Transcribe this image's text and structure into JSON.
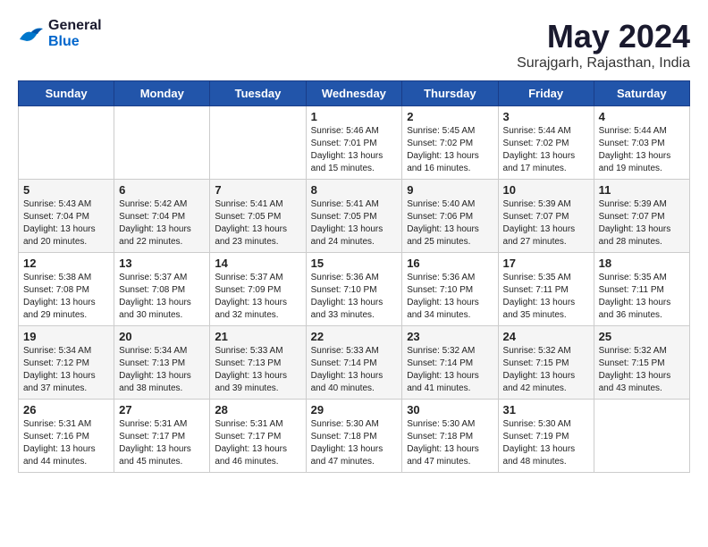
{
  "logo": {
    "line1": "General",
    "line2": "Blue"
  },
  "title": "May 2024",
  "subtitle": "Surajgarh, Rajasthan, India",
  "days_of_week": [
    "Sunday",
    "Monday",
    "Tuesday",
    "Wednesday",
    "Thursday",
    "Friday",
    "Saturday"
  ],
  "weeks": [
    [
      {
        "day": "",
        "info": ""
      },
      {
        "day": "",
        "info": ""
      },
      {
        "day": "",
        "info": ""
      },
      {
        "day": "1",
        "sunrise": "5:46 AM",
        "sunset": "7:01 PM",
        "daylight": "13 hours and 15 minutes."
      },
      {
        "day": "2",
        "sunrise": "5:45 AM",
        "sunset": "7:02 PM",
        "daylight": "13 hours and 16 minutes."
      },
      {
        "day": "3",
        "sunrise": "5:44 AM",
        "sunset": "7:02 PM",
        "daylight": "13 hours and 17 minutes."
      },
      {
        "day": "4",
        "sunrise": "5:44 AM",
        "sunset": "7:03 PM",
        "daylight": "13 hours and 19 minutes."
      }
    ],
    [
      {
        "day": "5",
        "sunrise": "5:43 AM",
        "sunset": "7:04 PM",
        "daylight": "13 hours and 20 minutes."
      },
      {
        "day": "6",
        "sunrise": "5:42 AM",
        "sunset": "7:04 PM",
        "daylight": "13 hours and 22 minutes."
      },
      {
        "day": "7",
        "sunrise": "5:41 AM",
        "sunset": "7:05 PM",
        "daylight": "13 hours and 23 minutes."
      },
      {
        "day": "8",
        "sunrise": "5:41 AM",
        "sunset": "7:05 PM",
        "daylight": "13 hours and 24 minutes."
      },
      {
        "day": "9",
        "sunrise": "5:40 AM",
        "sunset": "7:06 PM",
        "daylight": "13 hours and 25 minutes."
      },
      {
        "day": "10",
        "sunrise": "5:39 AM",
        "sunset": "7:07 PM",
        "daylight": "13 hours and 27 minutes."
      },
      {
        "day": "11",
        "sunrise": "5:39 AM",
        "sunset": "7:07 PM",
        "daylight": "13 hours and 28 minutes."
      }
    ],
    [
      {
        "day": "12",
        "sunrise": "5:38 AM",
        "sunset": "7:08 PM",
        "daylight": "13 hours and 29 minutes."
      },
      {
        "day": "13",
        "sunrise": "5:37 AM",
        "sunset": "7:08 PM",
        "daylight": "13 hours and 30 minutes."
      },
      {
        "day": "14",
        "sunrise": "5:37 AM",
        "sunset": "7:09 PM",
        "daylight": "13 hours and 32 minutes."
      },
      {
        "day": "15",
        "sunrise": "5:36 AM",
        "sunset": "7:10 PM",
        "daylight": "13 hours and 33 minutes."
      },
      {
        "day": "16",
        "sunrise": "5:36 AM",
        "sunset": "7:10 PM",
        "daylight": "13 hours and 34 minutes."
      },
      {
        "day": "17",
        "sunrise": "5:35 AM",
        "sunset": "7:11 PM",
        "daylight": "13 hours and 35 minutes."
      },
      {
        "day": "18",
        "sunrise": "5:35 AM",
        "sunset": "7:11 PM",
        "daylight": "13 hours and 36 minutes."
      }
    ],
    [
      {
        "day": "19",
        "sunrise": "5:34 AM",
        "sunset": "7:12 PM",
        "daylight": "13 hours and 37 minutes."
      },
      {
        "day": "20",
        "sunrise": "5:34 AM",
        "sunset": "7:13 PM",
        "daylight": "13 hours and 38 minutes."
      },
      {
        "day": "21",
        "sunrise": "5:33 AM",
        "sunset": "7:13 PM",
        "daylight": "13 hours and 39 minutes."
      },
      {
        "day": "22",
        "sunrise": "5:33 AM",
        "sunset": "7:14 PM",
        "daylight": "13 hours and 40 minutes."
      },
      {
        "day": "23",
        "sunrise": "5:32 AM",
        "sunset": "7:14 PM",
        "daylight": "13 hours and 41 minutes."
      },
      {
        "day": "24",
        "sunrise": "5:32 AM",
        "sunset": "7:15 PM",
        "daylight": "13 hours and 42 minutes."
      },
      {
        "day": "25",
        "sunrise": "5:32 AM",
        "sunset": "7:15 PM",
        "daylight": "13 hours and 43 minutes."
      }
    ],
    [
      {
        "day": "26",
        "sunrise": "5:31 AM",
        "sunset": "7:16 PM",
        "daylight": "13 hours and 44 minutes."
      },
      {
        "day": "27",
        "sunrise": "5:31 AM",
        "sunset": "7:17 PM",
        "daylight": "13 hours and 45 minutes."
      },
      {
        "day": "28",
        "sunrise": "5:31 AM",
        "sunset": "7:17 PM",
        "daylight": "13 hours and 46 minutes."
      },
      {
        "day": "29",
        "sunrise": "5:30 AM",
        "sunset": "7:18 PM",
        "daylight": "13 hours and 47 minutes."
      },
      {
        "day": "30",
        "sunrise": "5:30 AM",
        "sunset": "7:18 PM",
        "daylight": "13 hours and 47 minutes."
      },
      {
        "day": "31",
        "sunrise": "5:30 AM",
        "sunset": "7:19 PM",
        "daylight": "13 hours and 48 minutes."
      },
      {
        "day": "",
        "info": ""
      }
    ]
  ]
}
